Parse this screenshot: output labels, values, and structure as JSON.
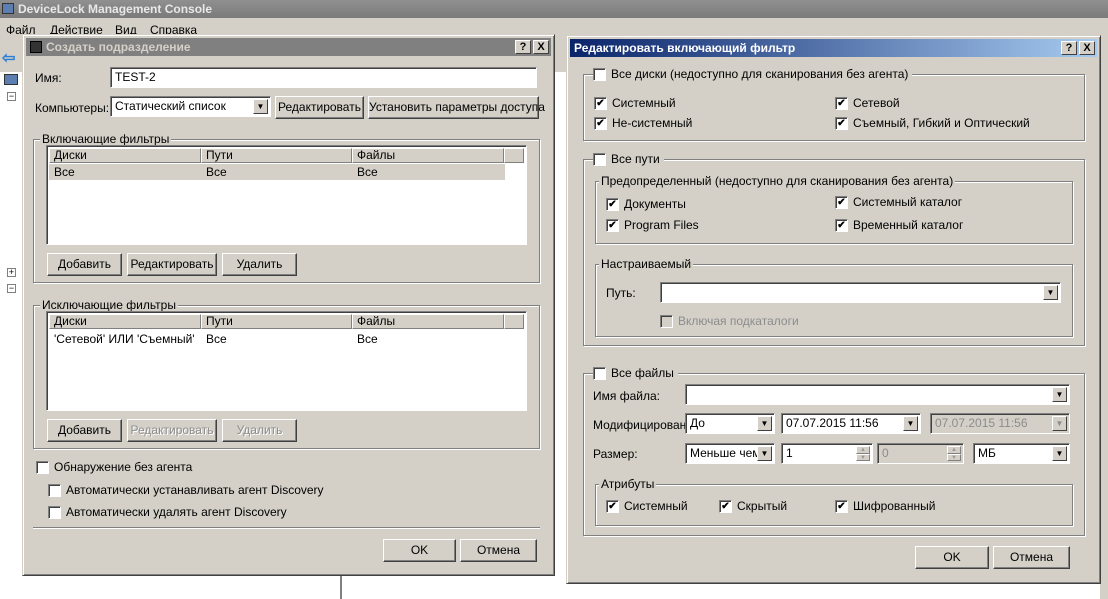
{
  "console": {
    "title": "DeviceLock Management Console",
    "menu": [
      "Файл",
      "Действие",
      "Вид",
      "Справка"
    ]
  },
  "colors": {
    "active_title_start": "#0a246a",
    "active_title_end": "#a6caf0",
    "inactive_title": "#808080",
    "face": "#d4d0c8"
  },
  "left_dialog": {
    "title": "Создать подразделение",
    "help": "?",
    "close": "X",
    "name_label": "Имя:",
    "name_value": "TEST-2",
    "computers_label": "Компьютеры:",
    "computers_value": "Статический список",
    "edit_button": "Редактировать",
    "access_button": "Установить параметры доступа",
    "include_group": {
      "label": "Включающие фильтры",
      "columns": [
        "Диски",
        "Пути",
        "Файлы"
      ],
      "rows": [
        [
          "Все",
          "Все",
          "Все"
        ]
      ],
      "add": "Добавить",
      "edit": "Редактировать",
      "delete": "Удалить"
    },
    "exclude_group": {
      "label": "Исключающие фильтры",
      "columns": [
        "Диски",
        "Пути",
        "Файлы"
      ],
      "rows": [
        [
          "'Сетевой' ИЛИ 'Съемный'",
          "Все",
          "Все"
        ]
      ],
      "add": "Добавить",
      "edit": "Редактировать",
      "delete": "Удалить"
    },
    "agentless": {
      "label": "Обнаружение без агента",
      "checked": false
    },
    "auto_install": {
      "label": "Автоматически устанавливать агент Discovery",
      "checked": false
    },
    "auto_remove": {
      "label": "Автоматически удалять агент Discovery",
      "checked": false
    },
    "ok": "OK",
    "cancel": "Отмена"
  },
  "right_dialog": {
    "title": "Редактировать включающий фильтр",
    "help": "?",
    "close": "X",
    "all_disks": {
      "label": "Все диски (недоступно для сканирования без агента)",
      "checked": false
    },
    "disks": [
      {
        "label": "Системный",
        "checked": true
      },
      {
        "label": "Сетевой",
        "checked": true
      },
      {
        "label": "Не-системный",
        "checked": true
      },
      {
        "label": "Съемный, Гибкий и Оптический",
        "checked": true
      }
    ],
    "all_paths": {
      "label": "Все пути",
      "checked": false
    },
    "predefined": {
      "label": "Предопределенный (недоступно для сканирования без агента)",
      "items": [
        {
          "label": "Документы",
          "checked": true
        },
        {
          "label": "Системный каталог",
          "checked": true
        },
        {
          "label": "Program Files",
          "checked": true
        },
        {
          "label": "Временный каталог",
          "checked": true
        }
      ]
    },
    "custom": {
      "label": "Настраиваемый",
      "path_label": "Путь:",
      "path_value": "",
      "subdirs": {
        "label": "Включая подкаталоги",
        "checked": false
      }
    },
    "all_files": {
      "label": "Все файлы",
      "checked": false
    },
    "filename_label": "Имя файла:",
    "filename_value": "",
    "modified_label": "Модифицирован:",
    "modified_op": "До",
    "modified_date1": "07.07.2015 11:56",
    "modified_date2": "07.07.2015 11:56",
    "size_label": "Размер:",
    "size_op": "Меньше чем",
    "size_value1": "1",
    "size_value2": "0",
    "size_unit": "МБ",
    "attributes": {
      "label": "Атрибуты",
      "items": [
        {
          "label": "Системный",
          "checked": true
        },
        {
          "label": "Скрытый",
          "checked": true
        },
        {
          "label": "Шифрованный",
          "checked": true
        }
      ]
    },
    "ok": "OK",
    "cancel": "Отмена"
  }
}
